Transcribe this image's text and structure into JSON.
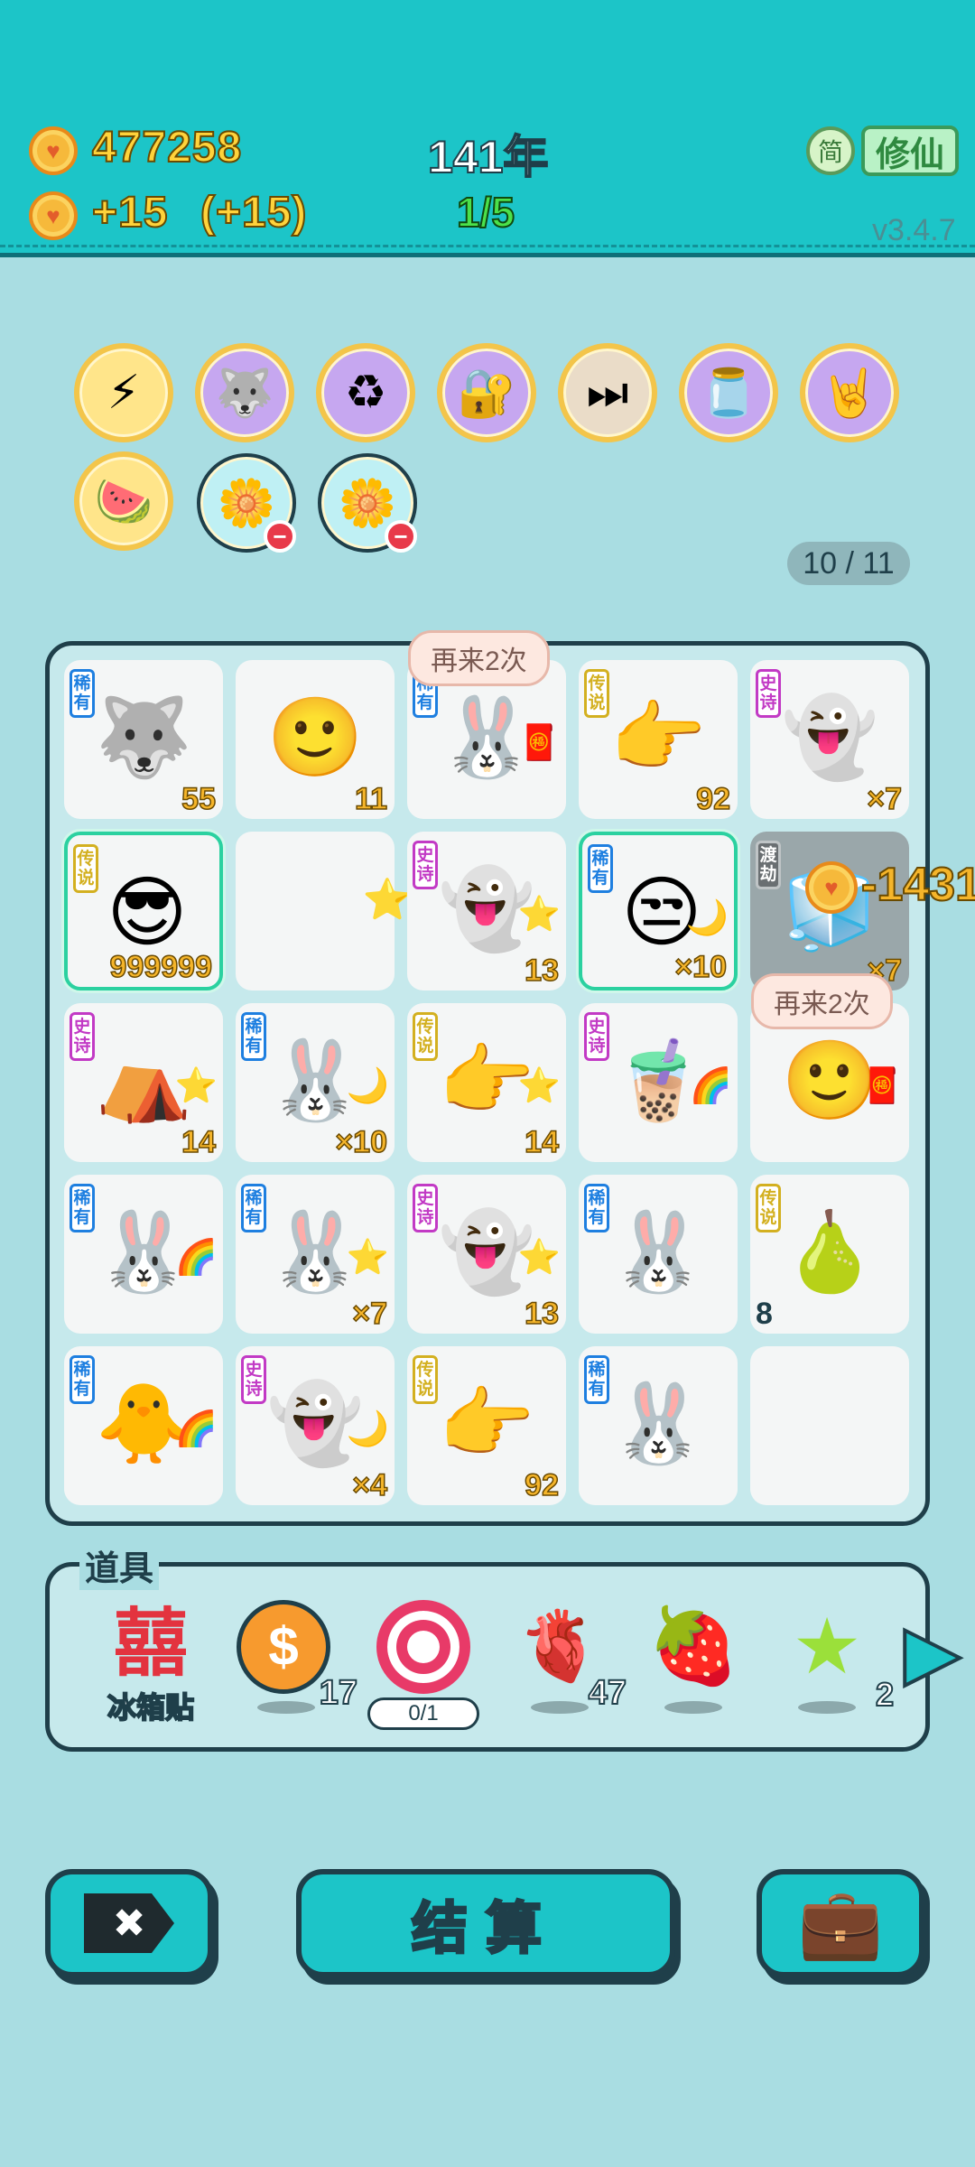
{
  "header": {
    "coins": "477258",
    "income": "+15",
    "income_bonus": "(+15)",
    "year": "141年",
    "round": "1/5",
    "lang_button": "简",
    "mode_button": "修仙",
    "version": "v3.4.7"
  },
  "icons_row": [
    "lightning-icon",
    "husky-icon",
    "recycle-icon",
    "safe-icon",
    "skip-icon",
    "jar-icon",
    "rock-hand-icon",
    "fruit-bowl-icon",
    "flower-pot-icon",
    "flower-pot-icon"
  ],
  "page_indicator": "10 / 11",
  "board": {
    "bubble_top": "再来2次",
    "bubble_side": "再来2次",
    "penalty": "-1431",
    "cells": [
      {
        "rarity": "稀有",
        "rcls": "r1",
        "icon": "🐺",
        "count": "55"
      },
      {
        "rarity": "",
        "rcls": "",
        "icon": "🙂",
        "count": "11"
      },
      {
        "rarity": "稀有",
        "rcls": "r1",
        "icon": "🐰",
        "count": "",
        "badge": "🧧"
      },
      {
        "rarity": "传说",
        "rcls": "r3",
        "icon": "👉",
        "count": "92"
      },
      {
        "rarity": "史诗",
        "rcls": "r2",
        "icon": "👻",
        "count": "×7"
      },
      {
        "rarity": "传说",
        "rcls": "r3",
        "icon": "😎",
        "count": "999999",
        "glow": true
      },
      {
        "rarity": "",
        "rcls": "",
        "icon": "⭐",
        "count": ""
      },
      {
        "rarity": "史诗",
        "rcls": "r2",
        "icon": "👻",
        "count": "13",
        "badge": "⭐"
      },
      {
        "rarity": "稀有",
        "rcls": "r1",
        "icon": "😒",
        "count": "×10",
        "glow": true,
        "badge": "🌙"
      },
      {
        "rarity": "渡劫",
        "rcls": "r4",
        "icon": "🧊",
        "count": "×7",
        "dark": true
      },
      {
        "rarity": "史诗",
        "rcls": "r2",
        "icon": "⛺",
        "count": "14",
        "badge": "⭐"
      },
      {
        "rarity": "稀有",
        "rcls": "r1",
        "icon": "🐰",
        "count": "×10",
        "badge": "🌙"
      },
      {
        "rarity": "传说",
        "rcls": "r3",
        "icon": "👉",
        "count": "14",
        "badge": "⭐"
      },
      {
        "rarity": "史诗",
        "rcls": "r2",
        "icon": "🧋",
        "count": "",
        "badge": "🌈"
      },
      {
        "rarity": "",
        "rcls": "",
        "icon": "🙂",
        "count": "",
        "badge": "🧧"
      },
      {
        "rarity": "稀有",
        "rcls": "r1",
        "icon": "🐰",
        "count": "",
        "badge": "🌈"
      },
      {
        "rarity": "稀有",
        "rcls": "r1",
        "icon": "🐰",
        "count": "×7",
        "badge": "⭐"
      },
      {
        "rarity": "史诗",
        "rcls": "r2",
        "icon": "👻",
        "count": "13",
        "badge": "⭐"
      },
      {
        "rarity": "稀有",
        "rcls": "r1",
        "icon": "🐰",
        "count": ""
      },
      {
        "rarity": "传说",
        "rcls": "r3",
        "icon": "🍐",
        "count": "8",
        "countLeft": true
      },
      {
        "rarity": "稀有",
        "rcls": "r1",
        "icon": "🐥",
        "count": "",
        "badge": "🌈"
      },
      {
        "rarity": "史诗",
        "rcls": "r2",
        "icon": "👻",
        "count": "×4",
        "badge": "🌙"
      },
      {
        "rarity": "传说",
        "rcls": "r3",
        "icon": "👉",
        "count": "92"
      },
      {
        "rarity": "稀有",
        "rcls": "r1",
        "icon": "🐰",
        "count": ""
      },
      {
        "rarity": "",
        "rcls": "",
        "icon": "",
        "count": ""
      }
    ]
  },
  "props": {
    "title": "道具",
    "items": [
      {
        "name": "fridge-sticker",
        "icon": "囍",
        "label": "冰箱贴",
        "count": ""
      },
      {
        "name": "coin-prop",
        "icon": "💲",
        "label": "",
        "count": "17"
      },
      {
        "name": "target-prop",
        "icon": "🎯",
        "label": "0/1",
        "count": ""
      },
      {
        "name": "liver-prop",
        "icon": "🫀",
        "label": "",
        "count": "47"
      },
      {
        "name": "strawberry-prop",
        "icon": "🍓",
        "label": "",
        "count": ""
      },
      {
        "name": "star-prop",
        "icon": "⭐",
        "label": "",
        "count": "2"
      }
    ],
    "next": "▶"
  },
  "footer": {
    "close": "✖",
    "settle": "结算",
    "bag": "💼"
  }
}
